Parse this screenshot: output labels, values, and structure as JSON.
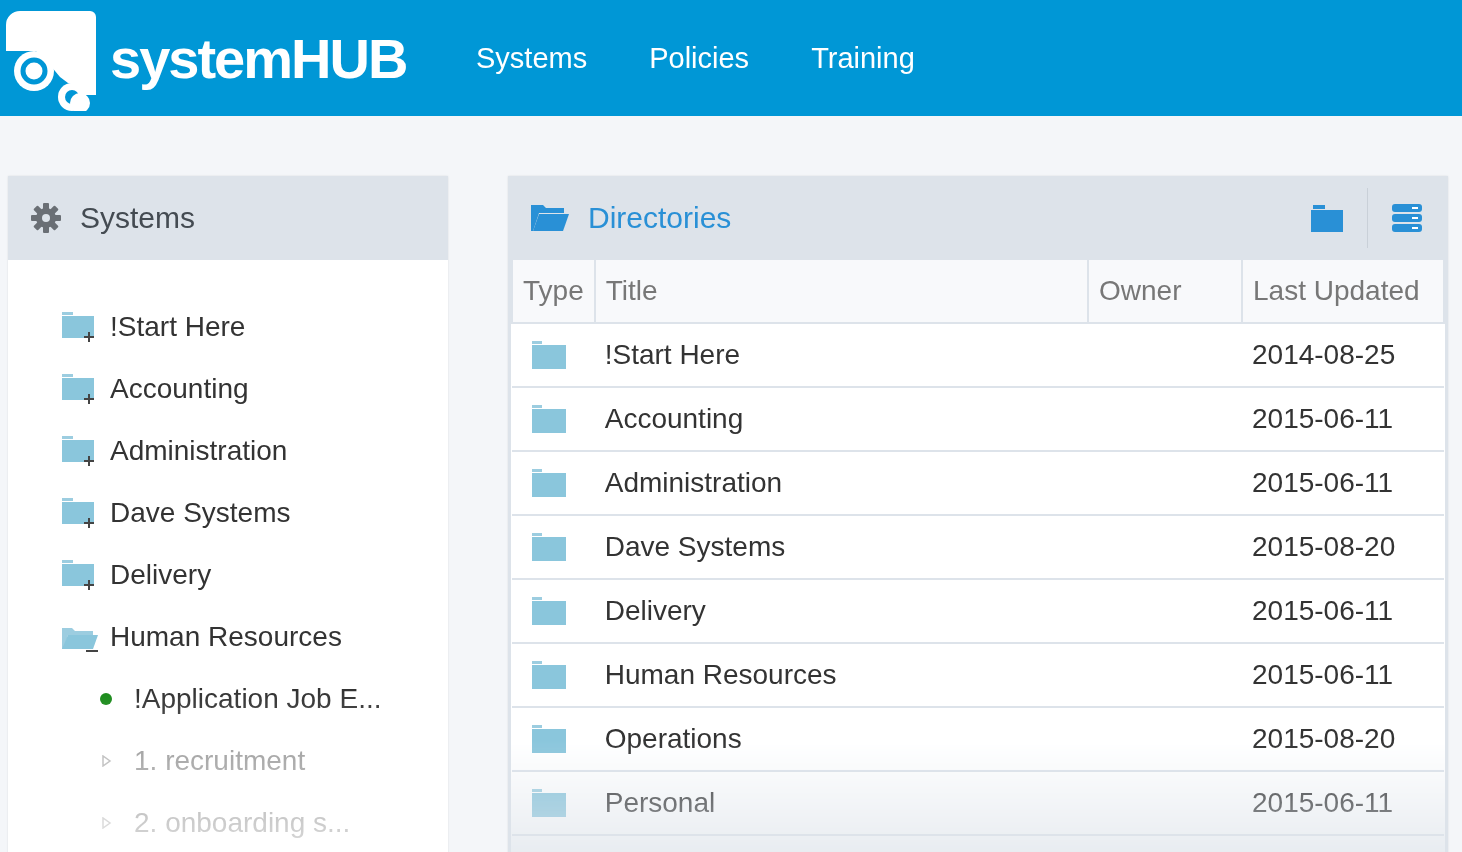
{
  "header": {
    "logo": "systemHUB",
    "nav": [
      {
        "label": "Systems"
      },
      {
        "label": "Policies"
      },
      {
        "label": "Training"
      }
    ]
  },
  "sidebar": {
    "title": "Systems",
    "tree": [
      {
        "kind": "folder",
        "label": "!Start Here",
        "expanded": false
      },
      {
        "kind": "folder",
        "label": "Accounting",
        "expanded": false
      },
      {
        "kind": "folder",
        "label": "Administration",
        "expanded": false
      },
      {
        "kind": "folder",
        "label": "Dave Systems",
        "expanded": false
      },
      {
        "kind": "folder",
        "label": "Delivery",
        "expanded": false
      },
      {
        "kind": "folder",
        "label": "Human Resources",
        "expanded": true,
        "children": [
          {
            "kind": "document",
            "label": "!Application Job E..."
          },
          {
            "kind": "subfolder",
            "label": "1. recruitment",
            "expanded": false
          },
          {
            "kind": "subfolder",
            "label": "2. onboarding s...",
            "expanded": false
          }
        ]
      }
    ]
  },
  "directories": {
    "title": "Directories",
    "table": {
      "columns": [
        "Type",
        "Title",
        "Owner",
        "Last Updated"
      ],
      "rows": [
        {
          "title": "!Start Here",
          "last_updated": "2014-08-25"
        },
        {
          "title": "Accounting",
          "last_updated": "2015-06-11"
        },
        {
          "title": "Administration",
          "last_updated": "2015-06-11"
        },
        {
          "title": "Dave Systems",
          "last_updated": "2015-08-20"
        },
        {
          "title": "Delivery",
          "last_updated": "2015-06-11"
        },
        {
          "title": "Human Resources",
          "last_updated": "2015-06-11"
        },
        {
          "title": "Operations",
          "last_updated": "2015-08-20"
        },
        {
          "title": "Personal",
          "last_updated": "2015-06-11"
        }
      ]
    }
  }
}
